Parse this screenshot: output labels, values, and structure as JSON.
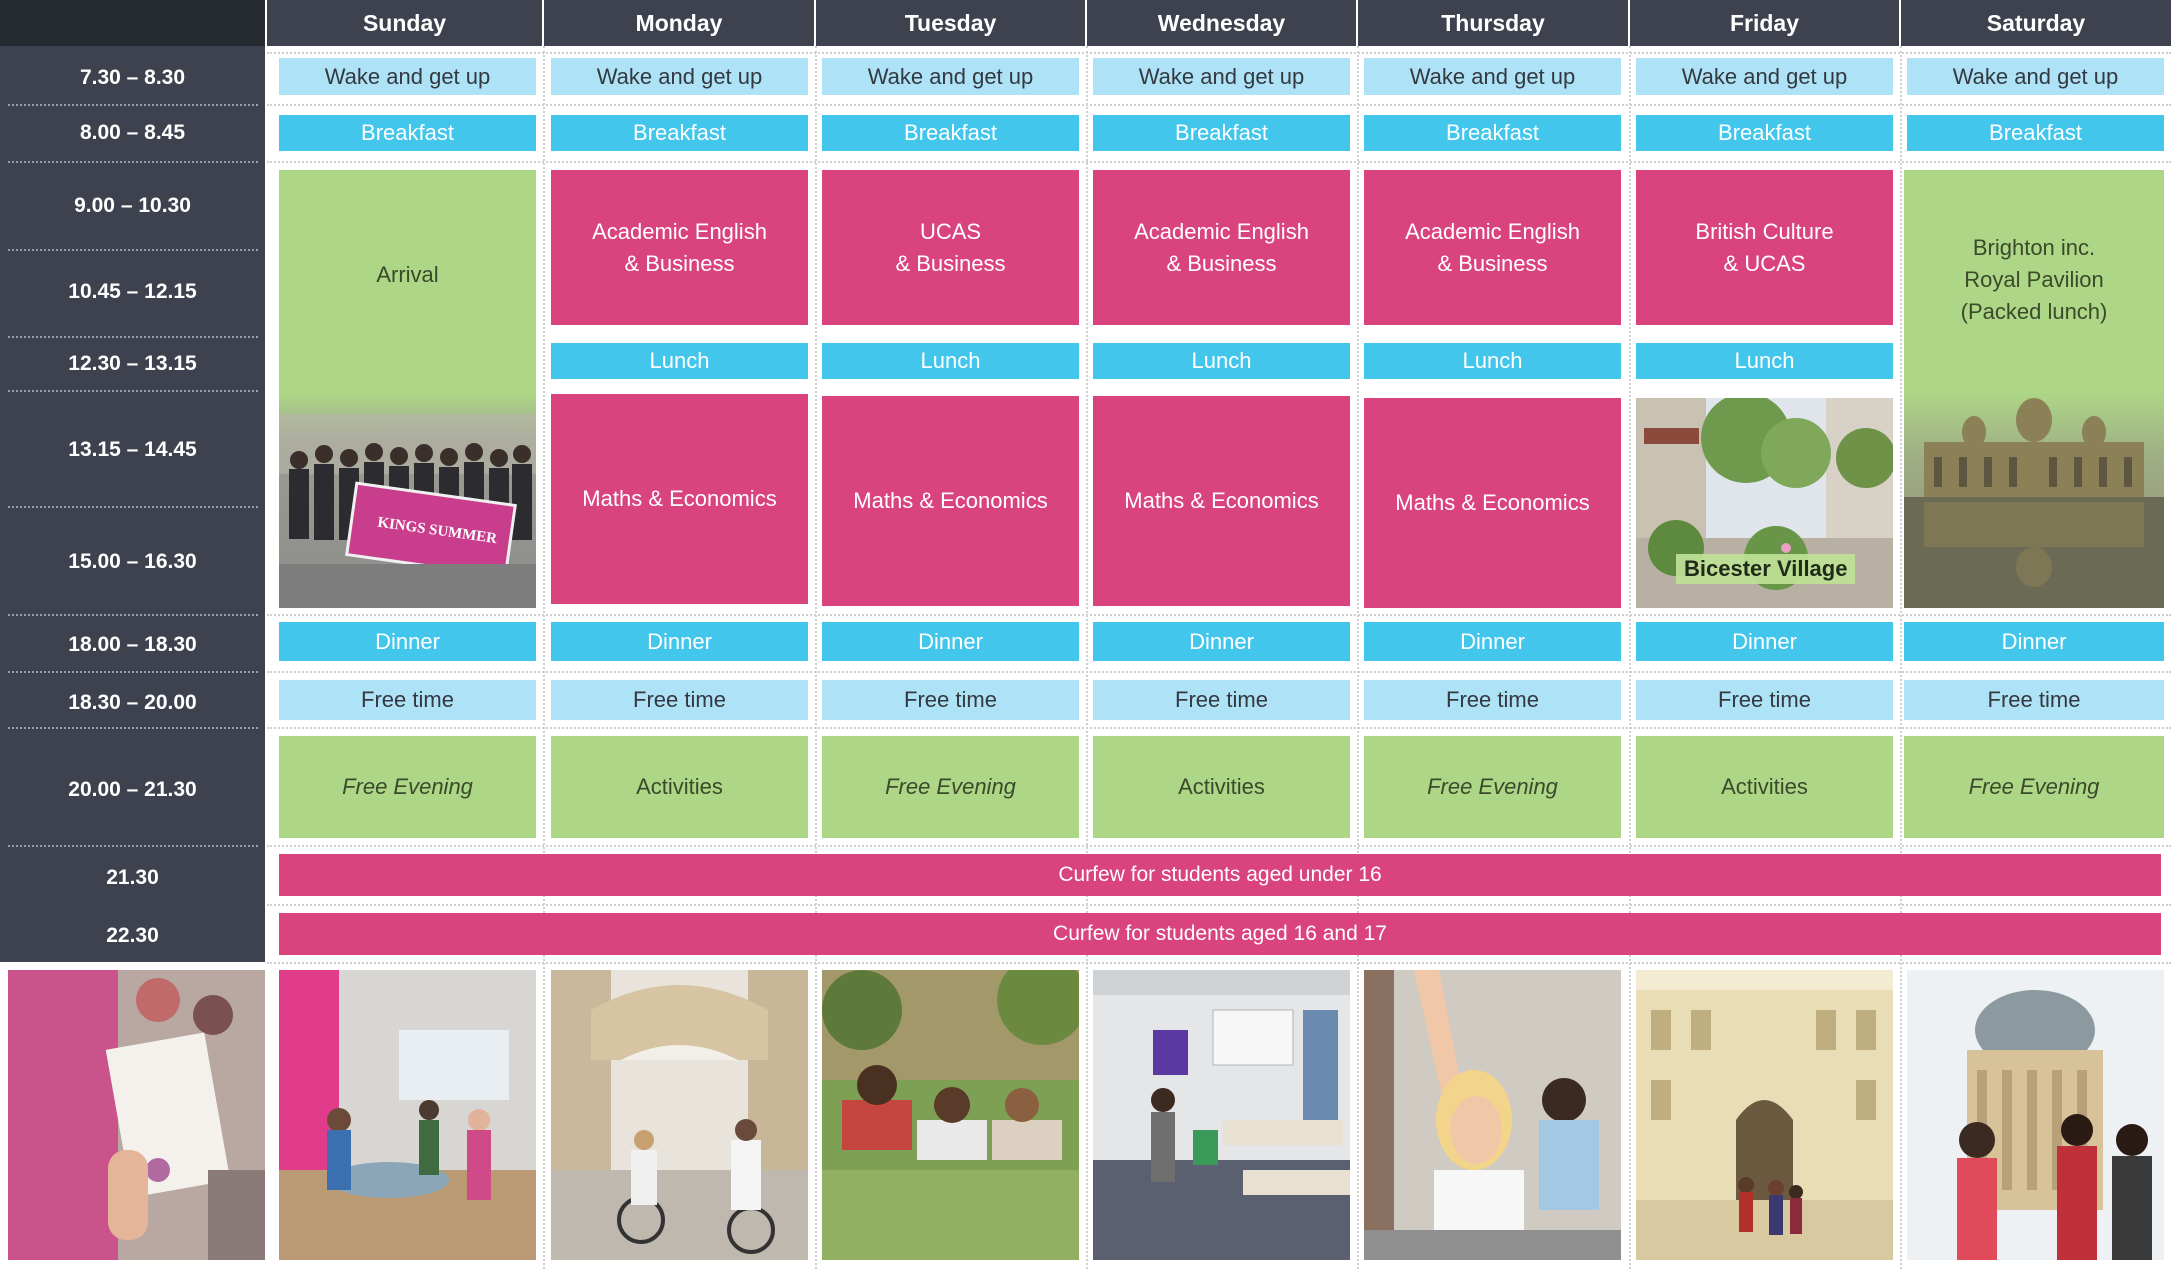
{
  "days": [
    "Sunday",
    "Monday",
    "Tuesday",
    "Wednesday",
    "Thursday",
    "Friday",
    "Saturday"
  ],
  "times": [
    "7.30 – 8.30",
    "8.00 – 8.45",
    "9.00 – 10.30",
    "10.45 – 12.15",
    "12.30 – 13.15",
    "13.15 – 14.45",
    "15.00 – 16.30",
    "18.00 – 18.30",
    "18.30 – 20.00",
    "20.00 – 21.30",
    "21.30",
    "22.30"
  ],
  "rows": {
    "wake": [
      "Wake and get up",
      "Wake and get up",
      "Wake and get up",
      "Wake and get up",
      "Wake and get up",
      "Wake and get up",
      "Wake and get up"
    ],
    "breakfast": [
      "Breakfast",
      "Breakfast",
      "Breakfast",
      "Breakfast",
      "Breakfast",
      "Breakfast",
      "Breakfast"
    ],
    "arrival": "Arrival",
    "morning": [
      "Academic English\n& Business",
      "UCAS\n& Business",
      "Academic English\n& Business",
      "Academic English\n& Business",
      "British Culture\n& UCAS"
    ],
    "saturday_trip": "Brighton inc.\nRoyal Pavilion\n(Packed lunch)",
    "lunch": [
      "Lunch",
      "Lunch",
      "Lunch",
      "Lunch",
      "Lunch"
    ],
    "afternoon": [
      "Maths & Economics",
      "Maths & Economics",
      "Maths & Economics",
      "Maths & Economics"
    ],
    "friday_trip": "Bicester Village",
    "dinner": [
      "Dinner",
      "Dinner",
      "Dinner",
      "Dinner",
      "Dinner",
      "Dinner",
      "Dinner"
    ],
    "free_time": [
      "Free time",
      "Free time",
      "Free time",
      "Free time",
      "Free time",
      "Free time",
      "Free time"
    ],
    "evening": [
      "Free Evening",
      "Activities",
      "Free Evening",
      "Activities",
      "Free Evening",
      "Activities",
      "Free Evening"
    ]
  },
  "curfews": [
    "Curfew for students aged under 16",
    "Curfew for students aged 16 and 17"
  ],
  "banner_photo": {
    "line1": "KINGS SUMMER"
  },
  "colors": {
    "header": "#3d424e",
    "light_blue": "#aee2f7",
    "blue": "#43c6ec",
    "pink": "#d9437e",
    "green": "#add686"
  },
  "photo_icons": [
    "certificate-photo-icon",
    "lounge-photo-icon",
    "bridge-of-sighs-photo-icon",
    "students-on-grass-photo-icon",
    "classroom-photo-icon",
    "student-raising-hand-photo-icon",
    "college-gate-photo-icon",
    "radcliffe-camera-photo-icon"
  ]
}
